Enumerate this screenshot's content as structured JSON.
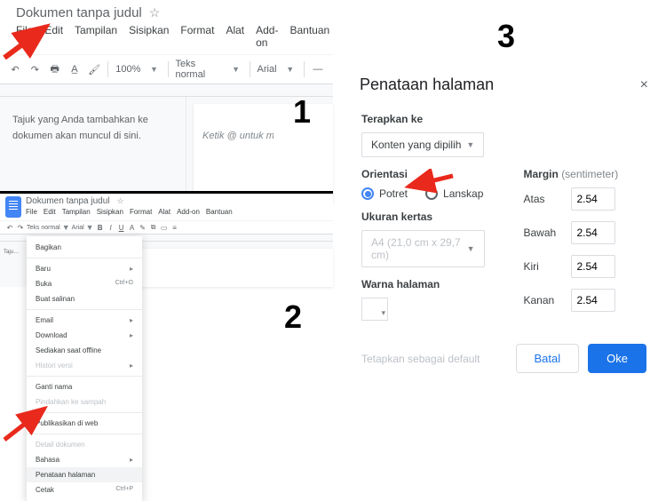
{
  "doc": {
    "title": "Dokumen tanpa judul",
    "menus": [
      "File",
      "Edit",
      "Tampilan",
      "Sisipkan",
      "Format",
      "Alat",
      "Add-on",
      "Bantuan"
    ]
  },
  "toolbar": {
    "zoom": "100%",
    "style": "Teks normal",
    "font": "Arial"
  },
  "outline": {
    "hint": "Tajuk yang Anda tambahkan ke dokumen akan muncul di sini."
  },
  "page": {
    "placeholder": "Ketik @ untuk menyisipkan"
  },
  "file_menu": {
    "bagikan": "Bagikan",
    "baru": "Baru",
    "buka": "Buka",
    "buka_shortcut": "Ctrl+O",
    "buat_salinan": "Buat salinan",
    "email": "Email",
    "download": "Download",
    "sediakan": "Sediakan saat offline",
    "histori": "Histori versi",
    "ganti_nama": "Ganti nama",
    "pindahkan": "Pindahkan ke sampah",
    "publikasikan": "Publikasikan di web",
    "detail": "Detail dokumen",
    "bahasa": "Bahasa",
    "penataan": "Penataan halaman",
    "cetak": "Cetak",
    "cetak_shortcut": "Ctrl+P"
  },
  "dialog": {
    "title": "Penataan halaman",
    "apply_to_label": "Terapkan ke",
    "apply_to_value": "Konten yang dipilih",
    "orientation_label": "Orientasi",
    "orientation_portrait": "Potret",
    "orientation_landscape": "Lanskap",
    "paper_label": "Ukuran kertas",
    "paper_value": "A4 (21,0 cm x 29,7 cm)",
    "color_label": "Warna halaman",
    "margin_label": "Margin",
    "margin_unit": "(sentimeter)",
    "margins": {
      "top_label": "Atas",
      "top": "2.54",
      "bottom_label": "Bawah",
      "bottom": "2.54",
      "left_label": "Kiri",
      "left": "2.54",
      "right_label": "Kanan",
      "right": "2.54"
    },
    "set_default": "Tetapkan sebagai default",
    "cancel": "Batal",
    "ok": "Oke"
  },
  "steps": {
    "n1": "1",
    "n2": "2",
    "n3": "3"
  }
}
